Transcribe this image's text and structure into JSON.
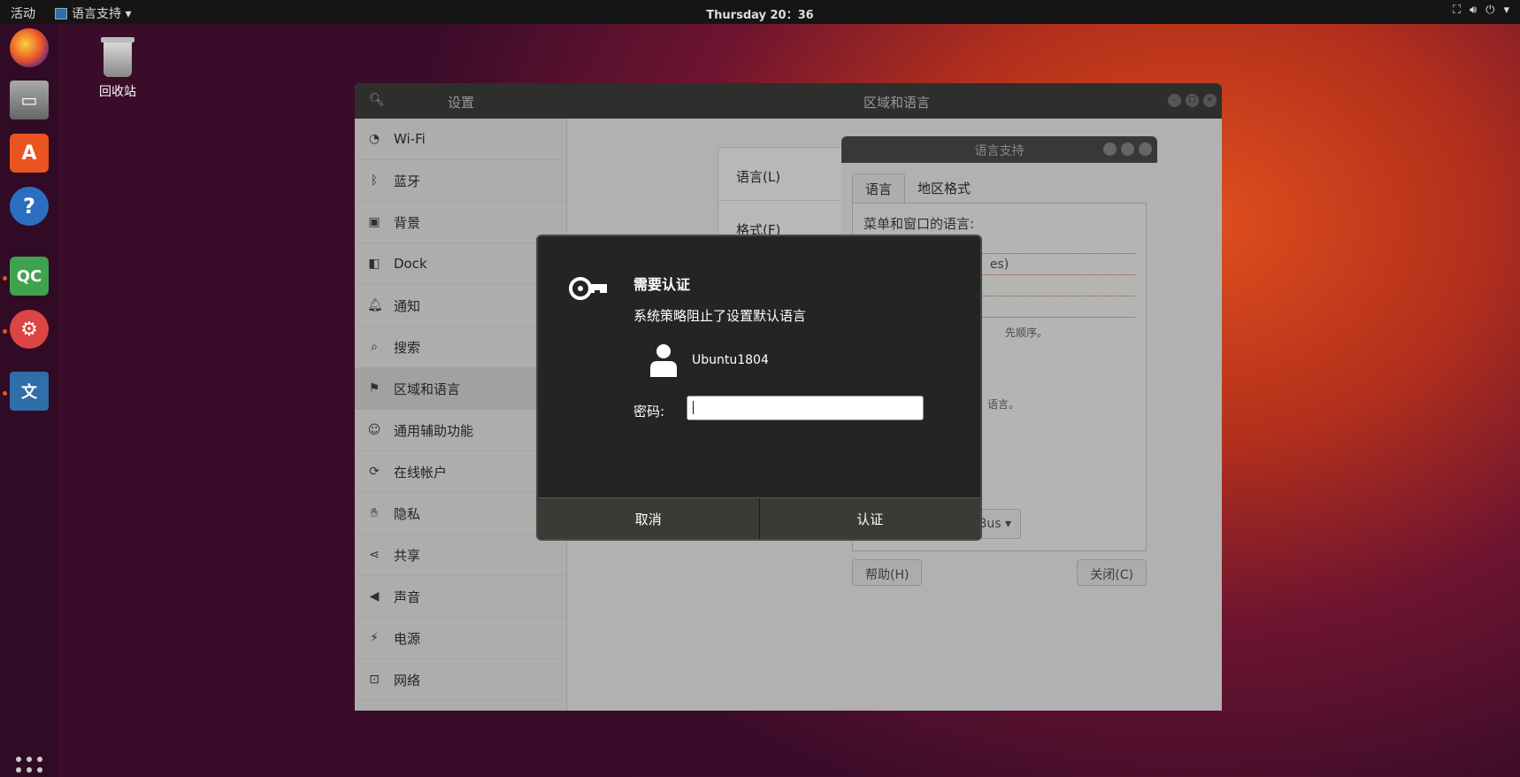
{
  "topbar": {
    "activities": "活动",
    "app_menu": "语言支持 ▾",
    "clock": "Thursday 20：36"
  },
  "dock": {
    "items": [
      "firefox",
      "files",
      "software",
      "help",
      "qt-creator",
      "settings-tool",
      "language-support"
    ],
    "show_apps": "show-applications"
  },
  "desktop": {
    "trash_label": "回收站"
  },
  "settings": {
    "title_left": "设置",
    "title_center": "区域和语言",
    "sidebar": [
      {
        "icon": "wifi-icon",
        "label": "Wi-Fi"
      },
      {
        "icon": "bluetooth-icon",
        "label": "蓝牙"
      },
      {
        "icon": "background-icon",
        "label": "背景"
      },
      {
        "icon": "dock-icon",
        "label": "Dock"
      },
      {
        "icon": "bell-icon",
        "label": "通知"
      },
      {
        "icon": "search-icon",
        "label": "搜索"
      },
      {
        "icon": "region-icon",
        "label": "区域和语言"
      },
      {
        "icon": "accessibility-icon",
        "label": "通用辅助功能"
      },
      {
        "icon": "online-accounts-icon",
        "label": "在线帐户"
      },
      {
        "icon": "privacy-icon",
        "label": "隐私"
      },
      {
        "icon": "share-icon",
        "label": "共享"
      },
      {
        "icon": "sound-icon",
        "label": "声音"
      },
      {
        "icon": "power-icon",
        "label": "电源"
      },
      {
        "icon": "network-icon",
        "label": "网络"
      }
    ],
    "language_label": "语言(L)",
    "formats_label": "格式(F)"
  },
  "language_support": {
    "title": "语言支持",
    "tab_language": "语言",
    "tab_region": "地区格式",
    "menu_label": "菜单和窗口的语言:",
    "line_partial_1": "es)",
    "hint_1": "先顺序。",
    "hint_2": "语言。",
    "input_method_partial": "IBus",
    "help_button": "帮助(H)",
    "close_button": "关闭(C)"
  },
  "auth": {
    "heading": "需要认证",
    "message": "系统策略阻止了设置默认语言",
    "username": "Ubuntu1804",
    "password_label": "密码:",
    "password_value": "",
    "cancel": "取消",
    "authenticate": "认证"
  }
}
